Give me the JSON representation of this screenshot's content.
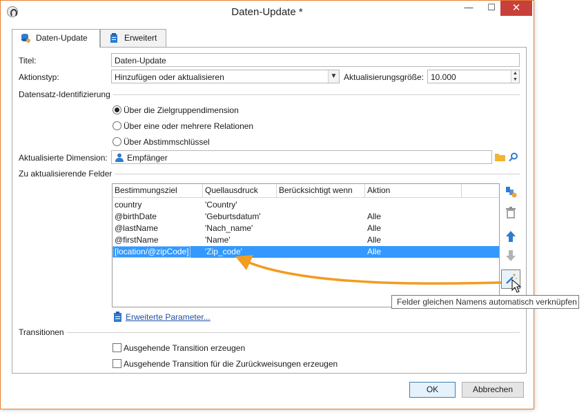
{
  "window": {
    "title": "Daten-Update *",
    "minimize": "—",
    "maximize": "☐",
    "close": "✕"
  },
  "tabs": [
    {
      "label": "Daten-Update",
      "icon": "database-gear-icon"
    },
    {
      "label": "Erweitert",
      "icon": "clipboard-icon"
    }
  ],
  "form": {
    "title_label": "Titel:",
    "title_value": "Daten-Update",
    "action_label": "Aktionstyp:",
    "action_value": "Hinzufügen oder aktualisieren",
    "batch_label": "Aktualisierungsgröße:",
    "batch_value": "10.000"
  },
  "identification": {
    "heading": "Datensatz-Identifizierung",
    "options": [
      {
        "label": "Über die Zielgruppendimension",
        "checked": true
      },
      {
        "label": "Über eine oder mehrere Relationen",
        "checked": false
      },
      {
        "label": "Über Abstimmschlüssel",
        "checked": false
      }
    ]
  },
  "dimension": {
    "label": "Aktualisierte Dimension:",
    "value": "Empfänger"
  },
  "fields": {
    "heading": "Zu aktualisierende Felder",
    "columns": [
      "Bestimmungsziel",
      "Quellausdruck",
      "Berücksichtigt wenn",
      "Aktion"
    ],
    "rows": [
      {
        "target": "country",
        "source": "'Country'",
        "condition": "",
        "action": ""
      },
      {
        "target": "@birthDate",
        "source": "'Geburtsdatum'",
        "condition": "",
        "action": "Alle"
      },
      {
        "target": "@lastName",
        "source": "'Nach_name'",
        "condition": "",
        "action": "Alle"
      },
      {
        "target": "@firstName",
        "source": "'Name'",
        "condition": "",
        "action": "Alle"
      },
      {
        "target": "[location/@zipCode]",
        "source": "'Zip_code'",
        "condition": "",
        "action": "Alle",
        "selected": true
      }
    ],
    "advanced_link": "Erweiterte Parameter...",
    "tooltip": "Felder gleichen Namens automatisch verknüpfen"
  },
  "transitions": {
    "heading": "Transitionen",
    "options": [
      {
        "label": "Ausgehende Transition erzeugen",
        "checked": false
      },
      {
        "label": "Ausgehende Transition für die Zurückweisungen erzeugen",
        "checked": false
      }
    ]
  },
  "buttons": {
    "ok": "OK",
    "cancel": "Abbrechen"
  },
  "colors": {
    "accent": "#3399ff",
    "arrow": "#f39c1f",
    "close": "#c7403a",
    "link": "#1f4fa6"
  }
}
